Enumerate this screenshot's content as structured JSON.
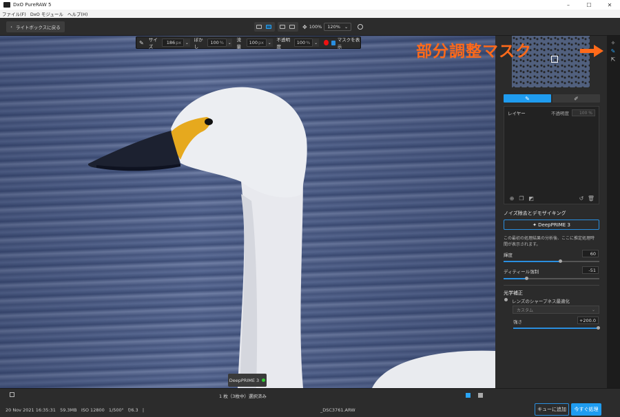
{
  "window": {
    "title": "DxO PureRAW 5",
    "controls": [
      "–",
      "☐",
      "✕"
    ]
  },
  "menu": [
    "ファイル(F)",
    "DxO モジュール",
    "ヘルプ(H)"
  ],
  "toolbar": {
    "back_label": "ライトボックスに戻る",
    "zoom_fit": "100%",
    "zoom_value": "120%",
    "zoom_arrow": "⌄",
    "info_icon": "info-icon"
  },
  "brush": {
    "size_label": "サイズ",
    "size_value": "186",
    "size_unit": "px",
    "feather_label": "ぼかし",
    "feather_value": "100",
    "feather_unit": "%",
    "flow_label": "流量",
    "flow_value": "100",
    "flow_unit": "px",
    "opacity_label": "不透明度",
    "opacity_value": "100",
    "opacity_unit": "%",
    "mask_label": "マスクを表示",
    "color": "#e11"
  },
  "annotation": {
    "text": "部分調整マスク",
    "color": "#ff6a1a"
  },
  "viewer": {
    "badge": "DeepPRIME 3"
  },
  "panel": {
    "tab_brush_icon": "brush-icon",
    "tab_eraser_icon": "eraser-icon",
    "layer_label": "レイヤー",
    "layer_opacity_label": "不透明度",
    "layer_opacity_value": "100 %",
    "noise_title": "ノイズ除去とデモザイキング",
    "deepprime_button": "✦ DeepPRIME 3",
    "desc": "この最初の処理結果の分析後、ここに推定処理時間が表示されます。",
    "luminance_label": "輝度",
    "luminance_value": "60",
    "luminance_fraction": 0.6,
    "detail_label": "ディティール強制",
    "detail_value": "-51",
    "detail_fraction": 0.245,
    "optics_title": "光学補正",
    "lens_label": "レンズのシャープネス最適化",
    "custom_label": "カスタム",
    "strength_label": "強さ",
    "strength_value": "+200.0",
    "strength_fraction": 1.0
  },
  "status": {
    "selection": "1 枚（3枚中）選択済み",
    "meta": "20 Nov 2021 16:35:31   59.3MB   ISO 12800   1/500\"   f/6.3   |",
    "filename": "_DSC3761.ARW",
    "queue_button": "キューに追加",
    "process_button": "今すぐ処理"
  }
}
